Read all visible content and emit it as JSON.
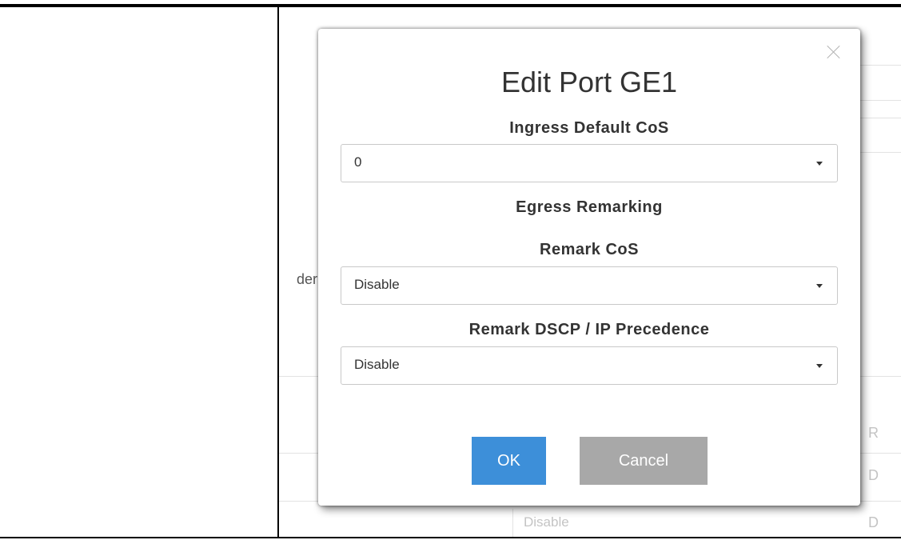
{
  "background": {
    "partial_label": "der",
    "col_header": "R",
    "row1_fragment": "D",
    "row2_fragment": "D",
    "row2_value": "Disable"
  },
  "modal": {
    "title": "Edit Port GE1",
    "ingress_label": "Ingress Default CoS",
    "ingress_value": "0",
    "egress_section": "Egress Remarking",
    "remark_cos_label": "Remark CoS",
    "remark_cos_value": "Disable",
    "remark_dscp_label": "Remark DSCP / IP Precedence",
    "remark_dscp_value": "Disable",
    "ok_label": "OK",
    "cancel_label": "Cancel"
  },
  "colors": {
    "ok_button": "#3d8fd9",
    "cancel_button": "#a8a8a8"
  }
}
